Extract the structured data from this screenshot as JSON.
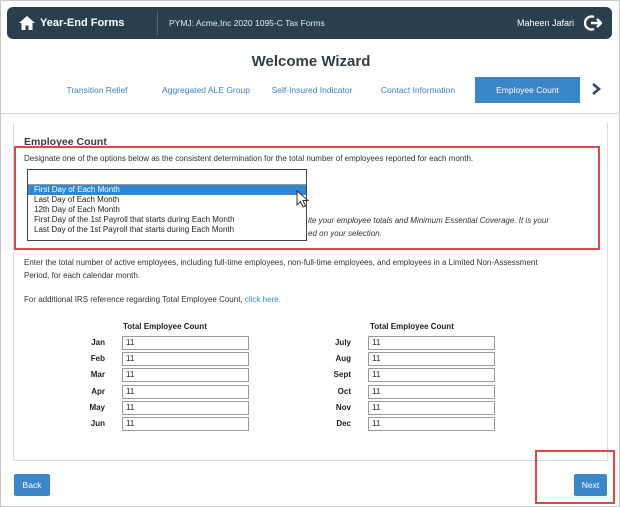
{
  "header": {
    "brand": "Year-End Forms",
    "company": "PYMJ: Acme,Inc 2020 1095-C Tax Forms",
    "user": "Maheen Jafari"
  },
  "page_title": "Welcome Wizard",
  "tabs": [
    {
      "label": "Transition Relief",
      "active": false
    },
    {
      "label": "Aggregated ALE Group",
      "active": false
    },
    {
      "label": "Self-Insured Indicator",
      "active": false
    },
    {
      "label": "Contact Information",
      "active": false
    },
    {
      "label": "Employee Count",
      "active": true
    }
  ],
  "section": {
    "heading": "Employee Count",
    "designate_text": "Designate one of the options below as the consistent determination for the total number of employees reported for each month.",
    "dropdown_options": [
      "First Day of Each Month",
      "Last Day of Each Month",
      "12th Day of Each Month",
      "First Day of the 1st Payroll that starts during Each Month",
      "Last Day of the 1st Payroll that starts during Each Month"
    ],
    "dropdown_selected_index": 0,
    "hidden_note_line1": "ite your employee totals and Minimum Essential Coverage. It is your",
    "hidden_note_line2": "ed on your selection.",
    "enter_text_line1": "Enter the total number of active employees, including full-time employees, non-full-time employees, and employees in a Limited Non-Assessment",
    "enter_text_line2": "Period, for each calendar month.",
    "irs_text": "For additional IRS reference regarding Total Employee Count,",
    "irs_link": "click here."
  },
  "counts": {
    "column_header": "Total Employee Count",
    "left": [
      {
        "month": "Jan",
        "value": "11"
      },
      {
        "month": "Feb",
        "value": "11"
      },
      {
        "month": "Mar",
        "value": "11"
      },
      {
        "month": "Apr",
        "value": "11"
      },
      {
        "month": "May",
        "value": "11"
      },
      {
        "month": "Jun",
        "value": "11"
      }
    ],
    "right": [
      {
        "month": "July",
        "value": "11"
      },
      {
        "month": "Aug",
        "value": "11"
      },
      {
        "month": "Sept",
        "value": "11"
      },
      {
        "month": "Oct",
        "value": "11"
      },
      {
        "month": "Nov",
        "value": "11"
      },
      {
        "month": "Dec",
        "value": "11"
      }
    ]
  },
  "footer": {
    "back_label": "Back",
    "next_label": "Next"
  },
  "colors": {
    "header_bg": "#2a3f4d",
    "accent": "#3a86c8",
    "highlight_box": "#e04848"
  },
  "icons": {
    "home": "home-icon",
    "logout": "logout-icon",
    "tabs_next": "chevron-right-icon",
    "cursor": "mouse-cursor-icon"
  }
}
